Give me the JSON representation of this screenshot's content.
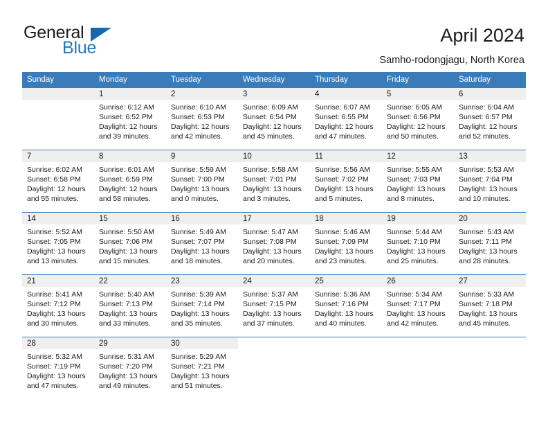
{
  "brand": {
    "name_part1": "General",
    "name_part2": "Blue"
  },
  "header": {
    "title": "April 2024",
    "subtitle": "Samho-rodongjagu, North Korea"
  },
  "colors": {
    "header_blue": "#3a7cba",
    "brand_blue": "#1f7ac4",
    "daynum_bg": "#efefef"
  },
  "weekdays": [
    "Sunday",
    "Monday",
    "Tuesday",
    "Wednesday",
    "Thursday",
    "Friday",
    "Saturday"
  ],
  "labels": {
    "sunrise_prefix": "Sunrise:",
    "sunset_prefix": "Sunset:",
    "daylight_prefix": "Daylight:"
  },
  "weeks": [
    [
      {
        "day": "",
        "empty": true
      },
      {
        "day": "1",
        "sunrise": "Sunrise: 6:12 AM",
        "sunset": "Sunset: 6:52 PM",
        "daylight": "Daylight: 12 hours and 39 minutes."
      },
      {
        "day": "2",
        "sunrise": "Sunrise: 6:10 AM",
        "sunset": "Sunset: 6:53 PM",
        "daylight": "Daylight: 12 hours and 42 minutes."
      },
      {
        "day": "3",
        "sunrise": "Sunrise: 6:09 AM",
        "sunset": "Sunset: 6:54 PM",
        "daylight": "Daylight: 12 hours and 45 minutes."
      },
      {
        "day": "4",
        "sunrise": "Sunrise: 6:07 AM",
        "sunset": "Sunset: 6:55 PM",
        "daylight": "Daylight: 12 hours and 47 minutes."
      },
      {
        "day": "5",
        "sunrise": "Sunrise: 6:05 AM",
        "sunset": "Sunset: 6:56 PM",
        "daylight": "Daylight: 12 hours and 50 minutes."
      },
      {
        "day": "6",
        "sunrise": "Sunrise: 6:04 AM",
        "sunset": "Sunset: 6:57 PM",
        "daylight": "Daylight: 12 hours and 52 minutes."
      }
    ],
    [
      {
        "day": "7",
        "sunrise": "Sunrise: 6:02 AM",
        "sunset": "Sunset: 6:58 PM",
        "daylight": "Daylight: 12 hours and 55 minutes."
      },
      {
        "day": "8",
        "sunrise": "Sunrise: 6:01 AM",
        "sunset": "Sunset: 6:59 PM",
        "daylight": "Daylight: 12 hours and 58 minutes."
      },
      {
        "day": "9",
        "sunrise": "Sunrise: 5:59 AM",
        "sunset": "Sunset: 7:00 PM",
        "daylight": "Daylight: 13 hours and 0 minutes."
      },
      {
        "day": "10",
        "sunrise": "Sunrise: 5:58 AM",
        "sunset": "Sunset: 7:01 PM",
        "daylight": "Daylight: 13 hours and 3 minutes."
      },
      {
        "day": "11",
        "sunrise": "Sunrise: 5:56 AM",
        "sunset": "Sunset: 7:02 PM",
        "daylight": "Daylight: 13 hours and 5 minutes."
      },
      {
        "day": "12",
        "sunrise": "Sunrise: 5:55 AM",
        "sunset": "Sunset: 7:03 PM",
        "daylight": "Daylight: 13 hours and 8 minutes."
      },
      {
        "day": "13",
        "sunrise": "Sunrise: 5:53 AM",
        "sunset": "Sunset: 7:04 PM",
        "daylight": "Daylight: 13 hours and 10 minutes."
      }
    ],
    [
      {
        "day": "14",
        "sunrise": "Sunrise: 5:52 AM",
        "sunset": "Sunset: 7:05 PM",
        "daylight": "Daylight: 13 hours and 13 minutes."
      },
      {
        "day": "15",
        "sunrise": "Sunrise: 5:50 AM",
        "sunset": "Sunset: 7:06 PM",
        "daylight": "Daylight: 13 hours and 15 minutes."
      },
      {
        "day": "16",
        "sunrise": "Sunrise: 5:49 AM",
        "sunset": "Sunset: 7:07 PM",
        "daylight": "Daylight: 13 hours and 18 minutes."
      },
      {
        "day": "17",
        "sunrise": "Sunrise: 5:47 AM",
        "sunset": "Sunset: 7:08 PM",
        "daylight": "Daylight: 13 hours and 20 minutes."
      },
      {
        "day": "18",
        "sunrise": "Sunrise: 5:46 AM",
        "sunset": "Sunset: 7:09 PM",
        "daylight": "Daylight: 13 hours and 23 minutes."
      },
      {
        "day": "19",
        "sunrise": "Sunrise: 5:44 AM",
        "sunset": "Sunset: 7:10 PM",
        "daylight": "Daylight: 13 hours and 25 minutes."
      },
      {
        "day": "20",
        "sunrise": "Sunrise: 5:43 AM",
        "sunset": "Sunset: 7:11 PM",
        "daylight": "Daylight: 13 hours and 28 minutes."
      }
    ],
    [
      {
        "day": "21",
        "sunrise": "Sunrise: 5:41 AM",
        "sunset": "Sunset: 7:12 PM",
        "daylight": "Daylight: 13 hours and 30 minutes."
      },
      {
        "day": "22",
        "sunrise": "Sunrise: 5:40 AM",
        "sunset": "Sunset: 7:13 PM",
        "daylight": "Daylight: 13 hours and 33 minutes."
      },
      {
        "day": "23",
        "sunrise": "Sunrise: 5:39 AM",
        "sunset": "Sunset: 7:14 PM",
        "daylight": "Daylight: 13 hours and 35 minutes."
      },
      {
        "day": "24",
        "sunrise": "Sunrise: 5:37 AM",
        "sunset": "Sunset: 7:15 PM",
        "daylight": "Daylight: 13 hours and 37 minutes."
      },
      {
        "day": "25",
        "sunrise": "Sunrise: 5:36 AM",
        "sunset": "Sunset: 7:16 PM",
        "daylight": "Daylight: 13 hours and 40 minutes."
      },
      {
        "day": "26",
        "sunrise": "Sunrise: 5:34 AM",
        "sunset": "Sunset: 7:17 PM",
        "daylight": "Daylight: 13 hours and 42 minutes."
      },
      {
        "day": "27",
        "sunrise": "Sunrise: 5:33 AM",
        "sunset": "Sunset: 7:18 PM",
        "daylight": "Daylight: 13 hours and 45 minutes."
      }
    ],
    [
      {
        "day": "28",
        "sunrise": "Sunrise: 5:32 AM",
        "sunset": "Sunset: 7:19 PM",
        "daylight": "Daylight: 13 hours and 47 minutes."
      },
      {
        "day": "29",
        "sunrise": "Sunrise: 5:31 AM",
        "sunset": "Sunset: 7:20 PM",
        "daylight": "Daylight: 13 hours and 49 minutes."
      },
      {
        "day": "30",
        "sunrise": "Sunrise: 5:29 AM",
        "sunset": "Sunset: 7:21 PM",
        "daylight": "Daylight: 13 hours and 51 minutes."
      },
      {
        "day": "",
        "empty": true
      },
      {
        "day": "",
        "empty": true
      },
      {
        "day": "",
        "empty": true
      },
      {
        "day": "",
        "empty": true
      }
    ]
  ]
}
